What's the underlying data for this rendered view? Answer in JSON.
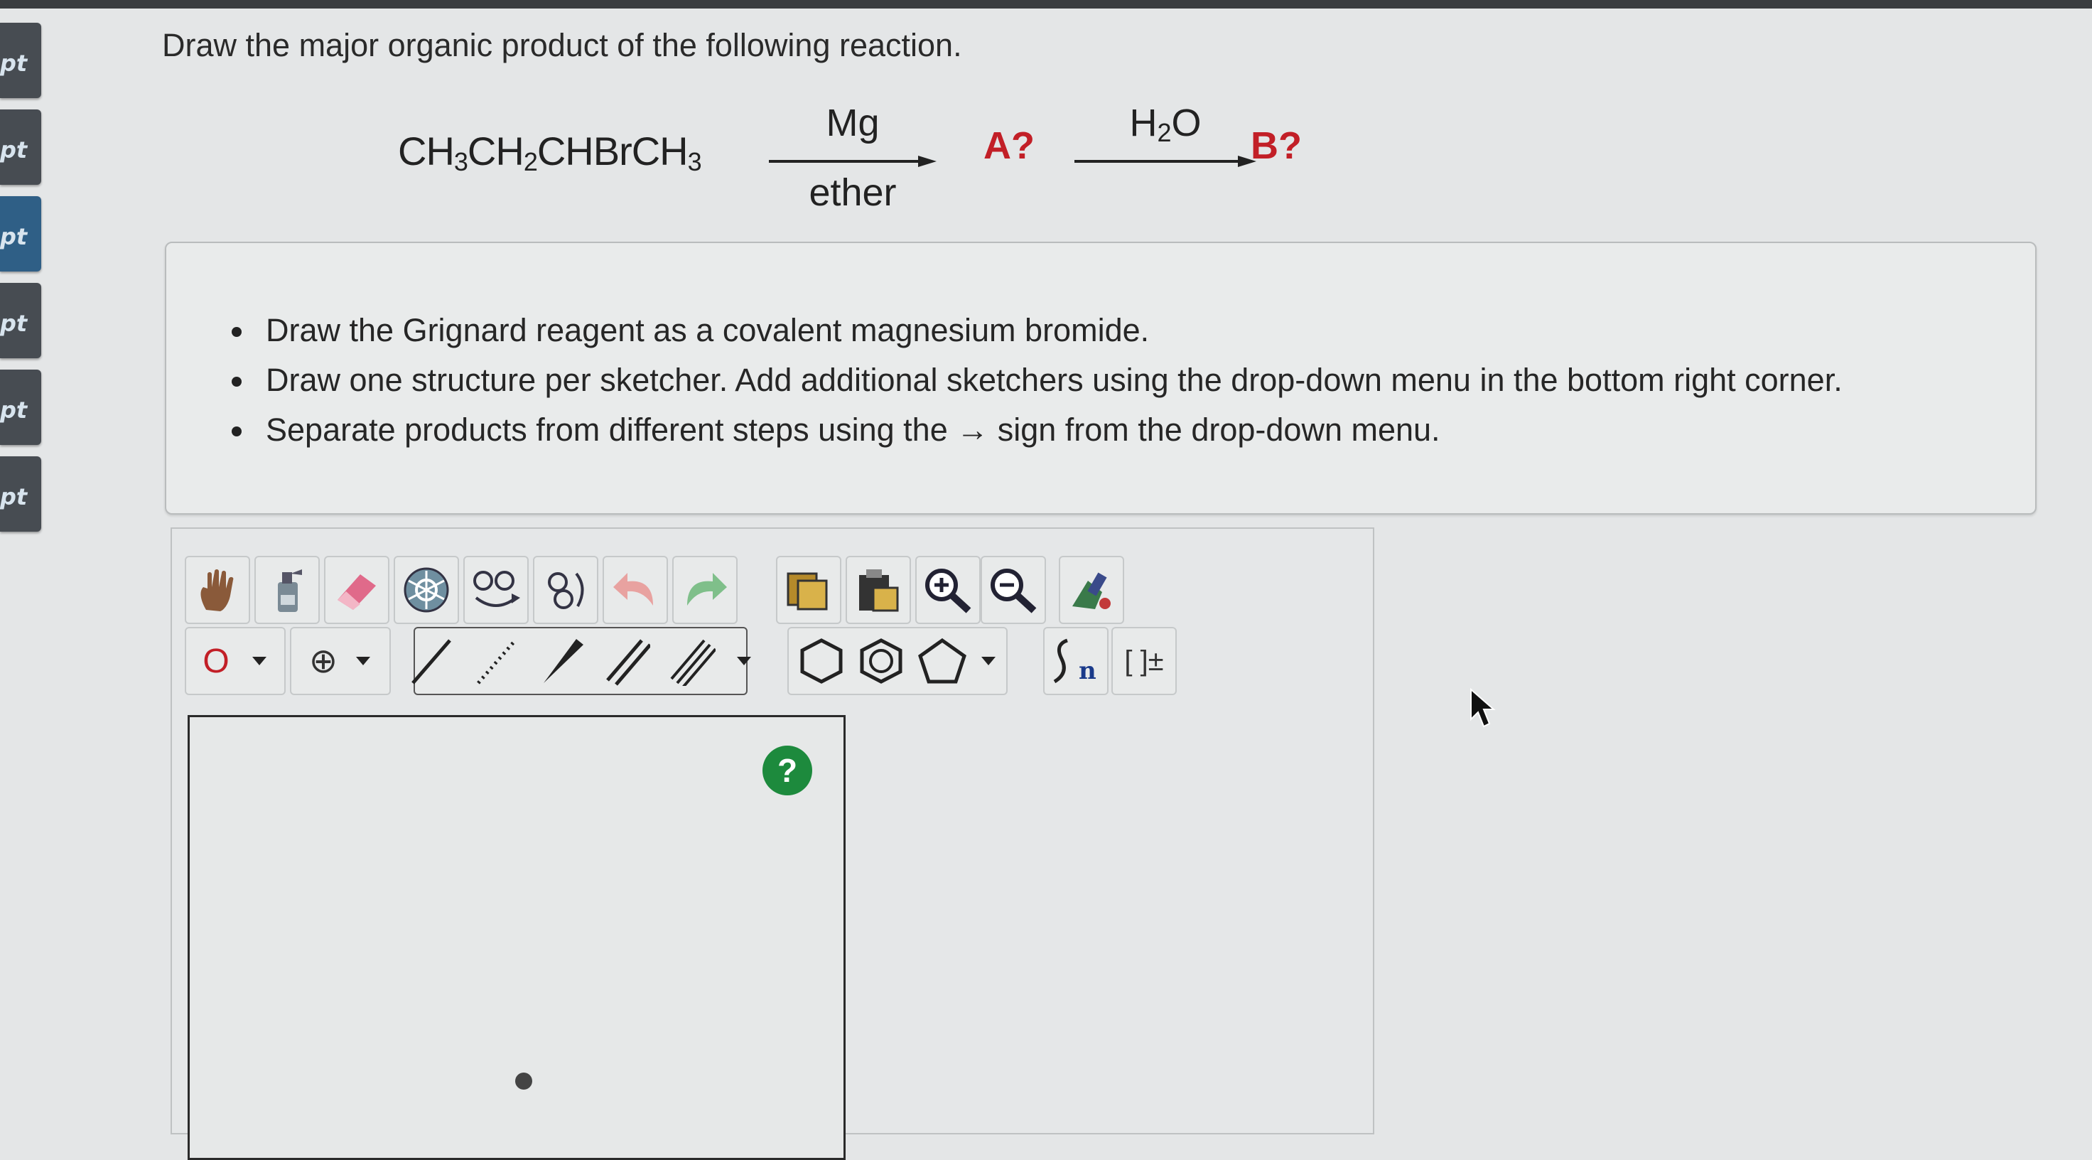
{
  "sidebar": {
    "items": [
      {
        "label": "pt"
      },
      {
        "label": "pt"
      },
      {
        "label": "pt"
      },
      {
        "label": "pt"
      },
      {
        "label": "pt"
      },
      {
        "label": "pt"
      }
    ]
  },
  "question": {
    "title": "Draw the major organic product of the following reaction."
  },
  "reaction": {
    "formula_parts": [
      "CH",
      "3",
      "CH",
      "2",
      "CHBrCH",
      "3"
    ],
    "step1_reagent_top": "Mg",
    "step1_reagent_bottom": "ether",
    "intermediate": "A?",
    "step2_reagent_parts": [
      "H",
      "2",
      "O"
    ],
    "product": "B?"
  },
  "instructions": [
    "Draw the Grignard reagent as a covalent magnesium bromide.",
    "Draw one structure per sketcher. Add additional sketchers using the drop-down menu in the bottom right corner.",
    "Separate products from different steps using the → sign from the drop-down menu."
  ],
  "sketcher": {
    "atom_label": "O",
    "charge_symbol": "⊕",
    "bracket_label": "[ ]±",
    "help_label": "?",
    "colors": {
      "help_button": "#1d8a3d",
      "atom_label": "#c21f27",
      "letters": "#c21f27"
    }
  }
}
